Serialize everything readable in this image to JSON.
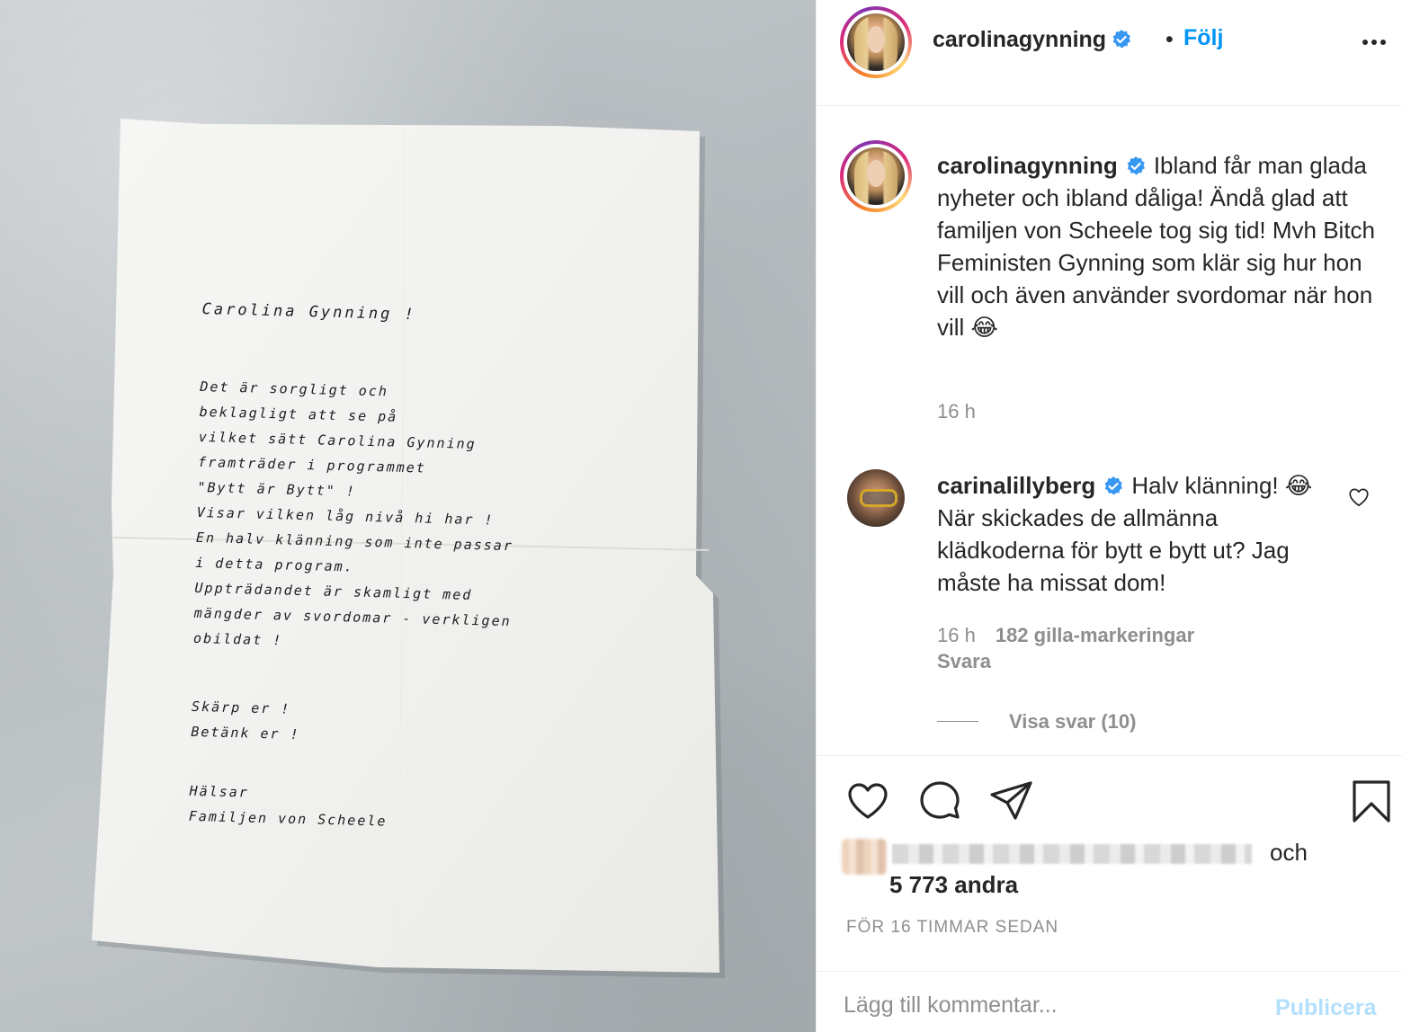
{
  "post": {
    "letter": {
      "title": "Carolina Gynning !",
      "paragraph1": [
        "Det är sorgligt och",
        "beklagligt att se på",
        "vilket sätt Carolina Gynning",
        "framträder i programmet",
        "\"Bytt är Bytt\" !",
        "Visar vilken låg nivå hi har !",
        "En halv klänning som inte passar",
        "i detta program.",
        "Uppträdandet är skamligt med",
        "mängder av svordomar - verkligen",
        "obildat !"
      ],
      "paragraph2": [
        "Skärp er !",
        "Betänk er !"
      ],
      "closing": [
        "Hälsar",
        "Familjen von Scheele"
      ]
    }
  },
  "header": {
    "username": "carolinagynning",
    "separator": "•",
    "follow_label": "Följ"
  },
  "caption": {
    "username": "carolinagynning",
    "text": "Ibland får man glada nyheter och ibland dåliga! Ändå glad att familjen von Scheele tog sig tid! Mvh Bitch Feministen Gynning som klär sig hur hon vill och även använder svordomar när hon vill 😂",
    "time": "16 h"
  },
  "comment": {
    "username": "carinalillyberg",
    "text": "Halv klänning! 😂 När skickades de allmänna klädkoderna för bytt e bytt ut? Jag måste ha missat dom!",
    "time": "16 h",
    "likes": "182 gilla-markeringar",
    "reply_label": "Svara",
    "view_replies_label": "Visa svar (10)"
  },
  "likes": {
    "suffix": "och",
    "count": "5 773 andra"
  },
  "timestamp": "FÖR 16 TIMMAR SEDAN",
  "add_comment": {
    "placeholder": "Lägg till kommentar...",
    "publish_label": "Publicera"
  },
  "colors": {
    "accent": "#0095f6",
    "verified": "#3897f0",
    "muted": "#8e8e8e",
    "publish_disabled": "#b2dffc"
  },
  "icons": [
    "more-icon",
    "verified-badge-icon",
    "heart-icon",
    "comment-icon",
    "share-icon",
    "bookmark-icon",
    "heart-small-icon"
  ]
}
